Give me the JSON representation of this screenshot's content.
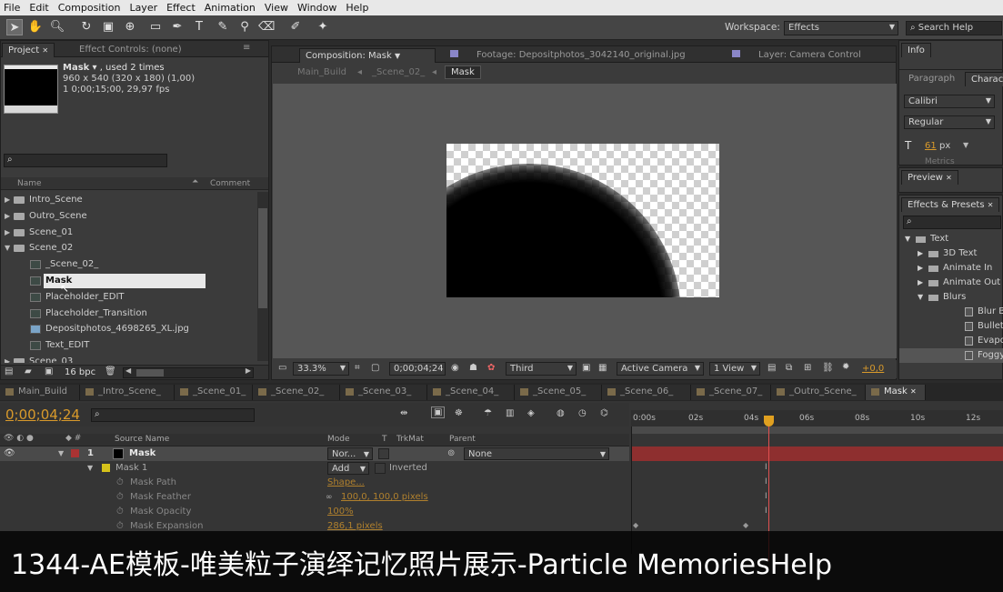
{
  "menu": [
    "File",
    "Edit",
    "Composition",
    "Layer",
    "Effect",
    "Animation",
    "View",
    "Window",
    "Help"
  ],
  "toolbar": {
    "workspace_label": "Workspace:",
    "workspace_value": "Effects",
    "search_help_placeholder": "Search Help"
  },
  "project": {
    "tab_project": "Project",
    "tab_effect_controls": "Effect Controls: (none)",
    "item_name": "Mask",
    "item_used": ", used 2 times",
    "item_size": "960 x 540  (320 x 180) (1,00)",
    "item_duration": "1 0;00;15;00, 29,97 fps",
    "col_name": "Name",
    "col_comment": "Comment",
    "items": [
      {
        "label": "Intro_Scene",
        "kind": "folder",
        "tri": "▶"
      },
      {
        "label": "Outro_Scene",
        "kind": "folder",
        "tri": "▶"
      },
      {
        "label": "Scene_01",
        "kind": "folder",
        "tri": "▶"
      },
      {
        "label": "Scene_02",
        "kind": "folder",
        "tri": "▼"
      },
      {
        "label": "_Scene_02_",
        "kind": "comp"
      },
      {
        "label": "Mask",
        "kind": "comp"
      },
      {
        "label": "Placeholder_EDIT",
        "kind": "comp"
      },
      {
        "label": "Placeholder_Transition",
        "kind": "comp"
      },
      {
        "label": "Depositphotos_4698265_XL.jpg",
        "kind": "image"
      },
      {
        "label": "Text_EDIT",
        "kind": "comp"
      },
      {
        "label": "Scene_03",
        "kind": "folder",
        "tri": "▶"
      }
    ],
    "bpc": "16 bpc"
  },
  "viewer": {
    "tab_composition": "Composition: Mask",
    "tab_footage": "Footage: Depositphotos_3042140_original.jpg",
    "tab_layer": "Layer: Camera Control",
    "breadcrumbs": [
      "Main_Build",
      "_Scene_02_",
      "Mask"
    ],
    "zoom": "33.3%",
    "timecode": "0;00;04;24",
    "resolution": "Third",
    "camera": "Active Camera",
    "views": "1 View",
    "exposure": "+0,0"
  },
  "right_panels": {
    "info": "Info",
    "paragraph": "Paragraph",
    "character": "Charac",
    "font": "Calibri",
    "style": "Regular",
    "size": "61",
    "size_unit": "px",
    "metrics": "Metrics",
    "preview": "Preview",
    "effects_presets": "Effects & Presets",
    "tree": [
      {
        "label": "Text",
        "indent": 0,
        "tri": "▼",
        "kind": "folder"
      },
      {
        "label": "3D Text",
        "indent": 1,
        "tri": "▶",
        "kind": "folder"
      },
      {
        "label": "Animate In",
        "indent": 1,
        "tri": "▶",
        "kind": "folder"
      },
      {
        "label": "Animate Out",
        "indent": 1,
        "tri": "▶",
        "kind": "folder"
      },
      {
        "label": "Blurs",
        "indent": 1,
        "tri": "▼",
        "kind": "folder"
      },
      {
        "label": "Blur By",
        "indent": 2,
        "tri": "",
        "kind": "preset"
      },
      {
        "label": "Bullet T",
        "indent": 2,
        "tri": "",
        "kind": "preset"
      },
      {
        "label": "Evapora",
        "indent": 2,
        "tri": "",
        "kind": "preset"
      },
      {
        "label": "Foggy",
        "indent": 2,
        "tri": "",
        "kind": "preset"
      }
    ]
  },
  "timeline": {
    "tabs": [
      "Main_Build",
      "_Intro_Scene_",
      "_Scene_01_",
      "_Scene_02_",
      "_Scene_03_",
      "_Scene_04_",
      "_Scene_05_",
      "_Scene_06_",
      "_Scene_07_",
      "_Outro_Scene_",
      "Mask"
    ],
    "timecode": "0;00;04;24",
    "col_source_name": "Source Name",
    "col_mode": "Mode",
    "col_t": "T",
    "col_trkmat": "TrkMat",
    "col_parent": "Parent",
    "layer_num": "1",
    "layer_name": "Mask",
    "layer_mode": "Nor...",
    "parent_value": "None",
    "mask_name": "Mask 1",
    "mask_mode": "Add",
    "inverted": "Inverted",
    "props": [
      {
        "name": "Mask Path",
        "value": "Shape..."
      },
      {
        "name": "Mask Feather",
        "value": "100,0, 100,0 pixels"
      },
      {
        "name": "Mask Opacity",
        "value": "100%"
      },
      {
        "name": "Mask Expansion",
        "value": "286,1 pixels"
      }
    ],
    "ruler": [
      "0:00s",
      "02s",
      "04s",
      "06s",
      "08s",
      "10s",
      "12s"
    ]
  },
  "caption": "1344-AE模板-唯美粒子演绎记忆照片展示-Particle MemoriesHelp",
  "colors": {
    "accent": "#d99a2b",
    "layer_bar": "#8e2f2f",
    "playhead": "#e0a020"
  }
}
